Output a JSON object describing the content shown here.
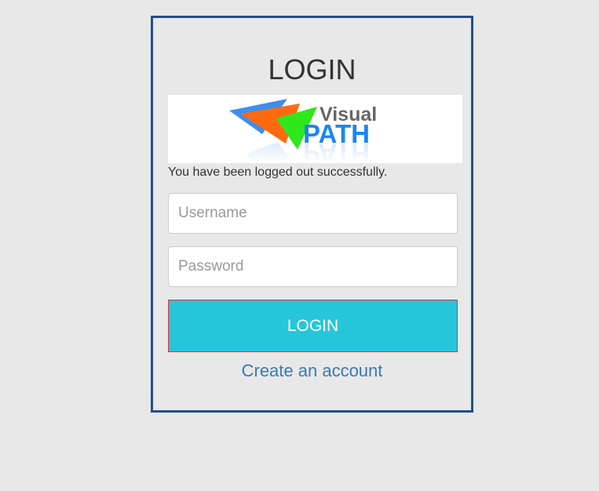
{
  "title": "LOGIN",
  "logo": {
    "text_top": "Visual",
    "text_bottom": "PATH"
  },
  "message": "You have been logged out successfully.",
  "form": {
    "username_placeholder": "Username",
    "username_value": "",
    "password_placeholder": "Password",
    "password_value": "",
    "login_label": "LOGIN"
  },
  "create_account_label": "Create an account",
  "colors": {
    "background": "#e8e8e8",
    "border": "#234e8e",
    "button": "#26c6da",
    "button_border": "#f03030",
    "link": "#3a78b5"
  }
}
